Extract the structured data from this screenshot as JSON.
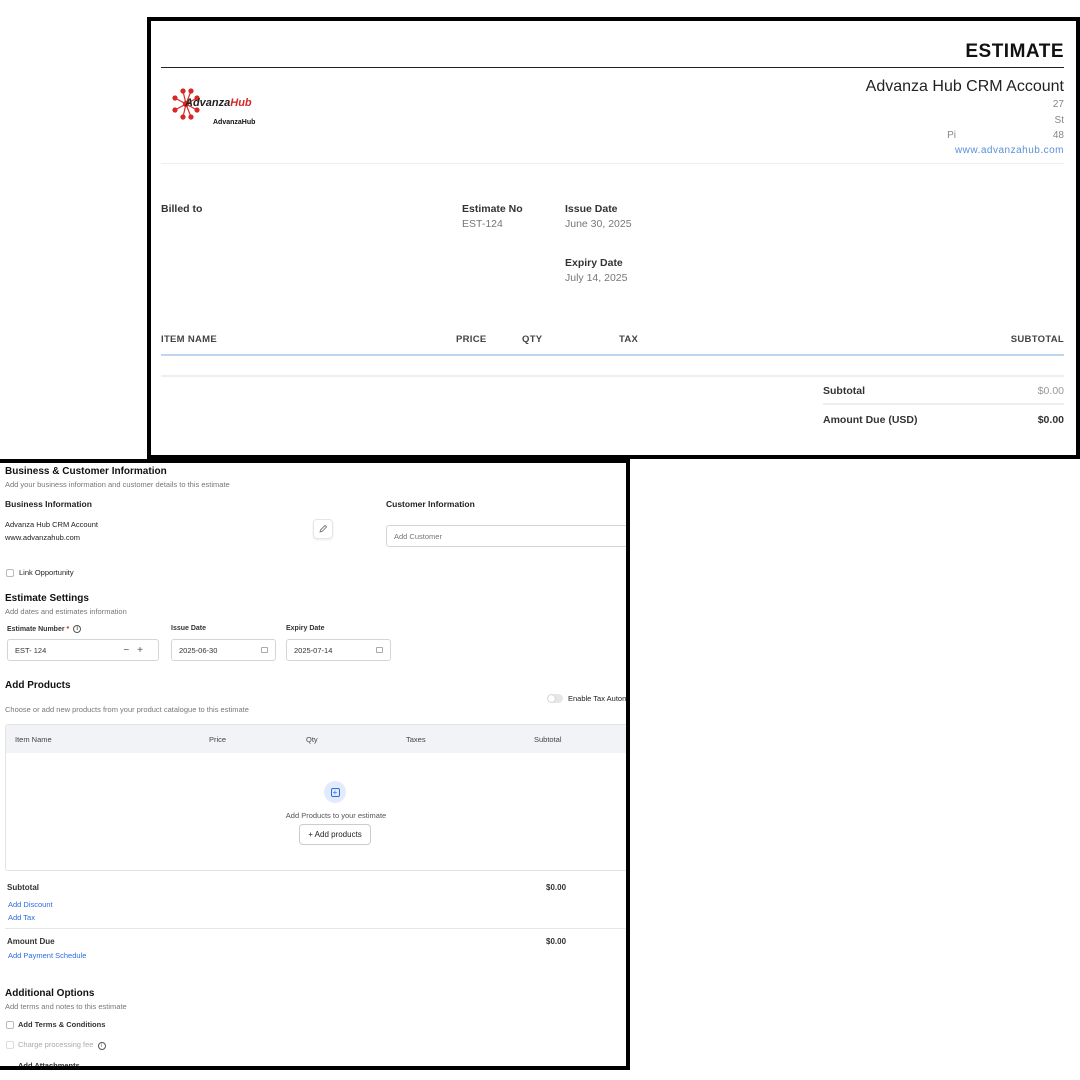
{
  "preview": {
    "title": "ESTIMATE",
    "logo_text_a": "Advanza",
    "logo_text_b": "Hub",
    "logo_caption": "AdvanzaHub",
    "company_name": "Advanza Hub CRM Account",
    "address_lines": [
      "27",
      "St",
      "Pi",
      "48"
    ],
    "website": "www.advanzahub.com",
    "billed_to_label": "Billed to",
    "estimate_no_label": "Estimate No",
    "estimate_no": "EST-124",
    "issue_date_label": "Issue Date",
    "issue_date": "June 30, 2025",
    "expiry_date_label": "Expiry Date",
    "expiry_date": "July 14, 2025",
    "columns": {
      "item": "ITEM NAME",
      "price": "PRICE",
      "qty": "QTY",
      "tax": "TAX",
      "subtotal": "SUBTOTAL"
    },
    "subtotal_label": "Subtotal",
    "subtotal_value": "$0.00",
    "amount_due_label": "Amount Due (USD)",
    "amount_due_value": "$0.00"
  },
  "editor": {
    "section_title": "Business & Customer Information",
    "section_sub": "Add your business information and customer details to this estimate",
    "business_info_label": "Business Information",
    "business_name": "Advanza Hub CRM Account",
    "business_web": "www.advanzahub.com",
    "customer_info_label": "Customer Information",
    "customer_placeholder": "Add Customer",
    "link_opportunity": "Link Opportunity",
    "settings_title": "Estimate Settings",
    "settings_sub": "Add dates and estimates information",
    "estimate_number_label": "Estimate Number",
    "required_mark": "*",
    "estimate_number_value": "EST- 124",
    "issue_date_label": "Issue Date",
    "issue_date_value": "2025-06-30",
    "expiry_date_label": "Expiry Date",
    "expiry_date_value": "2025-07-14",
    "products_title": "Add Products",
    "products_sub": "Choose or add new products from your product catalogue to this estimate",
    "tax_toggle_label": "Enable Tax Autom",
    "table_headers": {
      "item": "Item Name",
      "price": "Price",
      "qty": "Qty",
      "taxes": "Taxes",
      "subtotal": "Subtotal"
    },
    "empty_text": "Add Products to your estimate",
    "add_products_button": "+ Add products",
    "subtotal_label": "Subtotal",
    "subtotal_value": "$0.00",
    "add_discount": "Add Discount",
    "add_tax": "Add Tax",
    "amount_due_label": "Amount Due",
    "amount_due_value": "$0.00",
    "add_payment_schedule": "Add Payment Schedule",
    "options_title": "Additional Options",
    "options_sub": "Add terms and notes to this estimate",
    "terms_label": "Add Terms & Conditions",
    "processing_fee_label": "Charge processing fee",
    "attachments_label": "Add Attachments"
  },
  "colors": {
    "link": "#2d6ce0",
    "accent_line": "#bdd7ee",
    "logo_red": "#d62828"
  }
}
